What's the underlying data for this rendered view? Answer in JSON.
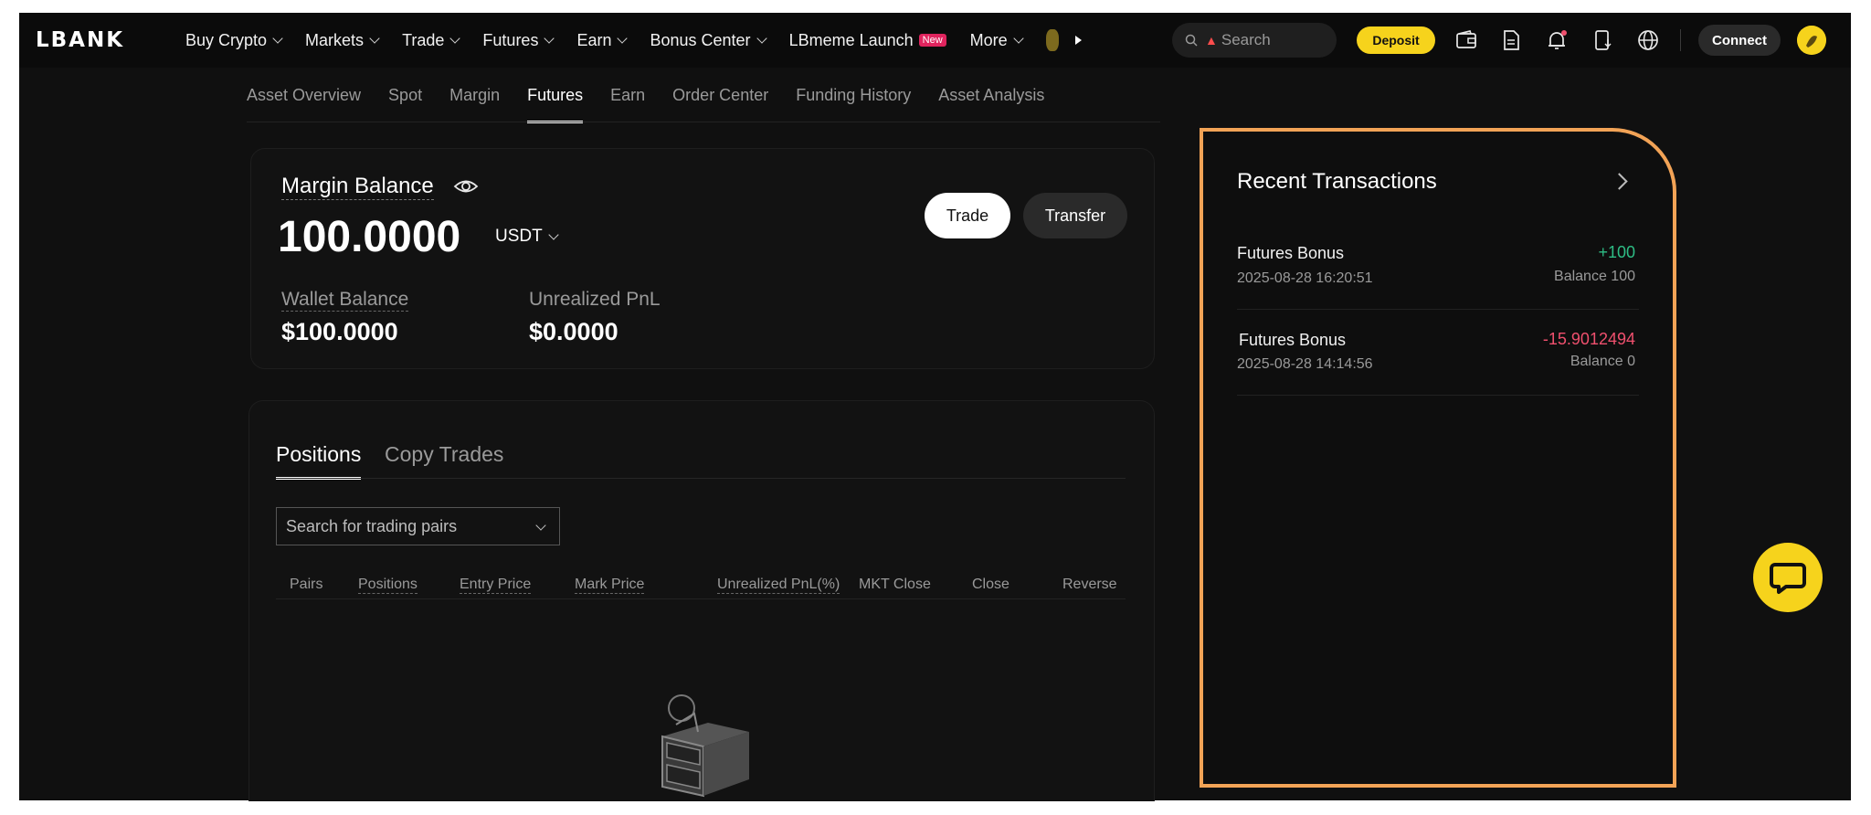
{
  "nav": {
    "logo": "LBANK",
    "items": [
      {
        "label": "Buy Crypto",
        "has_menu": true
      },
      {
        "label": "Markets",
        "has_menu": true
      },
      {
        "label": "Trade",
        "has_menu": true
      },
      {
        "label": "Futures",
        "has_menu": true
      },
      {
        "label": "Earn",
        "has_menu": true
      },
      {
        "label": "Bonus Center",
        "has_menu": true
      },
      {
        "label": "LBmeme Launch",
        "has_menu": false
      },
      {
        "label": "More",
        "has_menu": true
      }
    ],
    "new_badge": "New",
    "search_placeholder": "Search",
    "deposit_label": "Deposit",
    "connect_label": "Connect"
  },
  "subnav": {
    "tabs": [
      "Asset Overview",
      "Spot",
      "Margin",
      "Futures",
      "Earn",
      "Order Center",
      "Funding History",
      "Asset Analysis"
    ],
    "active": "Futures"
  },
  "balance": {
    "margin_label": "Margin Balance",
    "margin_value": "100.0000",
    "currency": "USDT",
    "wallet_label": "Wallet Balance",
    "wallet_value": "$100.0000",
    "unrealized_label": "Unrealized PnL",
    "unrealized_value": "$0.0000",
    "trade_label": "Trade",
    "transfer_label": "Transfer"
  },
  "positions": {
    "tabs": [
      "Positions",
      "Copy Trades"
    ],
    "search_placeholder": "Search for trading pairs",
    "columns": [
      "Pairs",
      "Positions",
      "Entry Price",
      "Mark Price",
      "Unrealized PnL(%)",
      "MKT Close",
      "Close",
      "Reverse"
    ]
  },
  "recent": {
    "title": "Recent Transactions",
    "items": [
      {
        "name": "Futures Bonus",
        "time": "2025-08-28 16:20:51",
        "amount": "+100",
        "balance": "Balance 100"
      },
      {
        "name": "Futures Bonus",
        "time": "2025-08-28 14:14:56",
        "amount": "-15.9012494",
        "balance": "Balance 0"
      }
    ]
  },
  "colors": {
    "accent_yellow": "#f6d31c",
    "positive": "#2ebd85",
    "negative": "#f0506e",
    "highlight_border": "#f2a356"
  }
}
